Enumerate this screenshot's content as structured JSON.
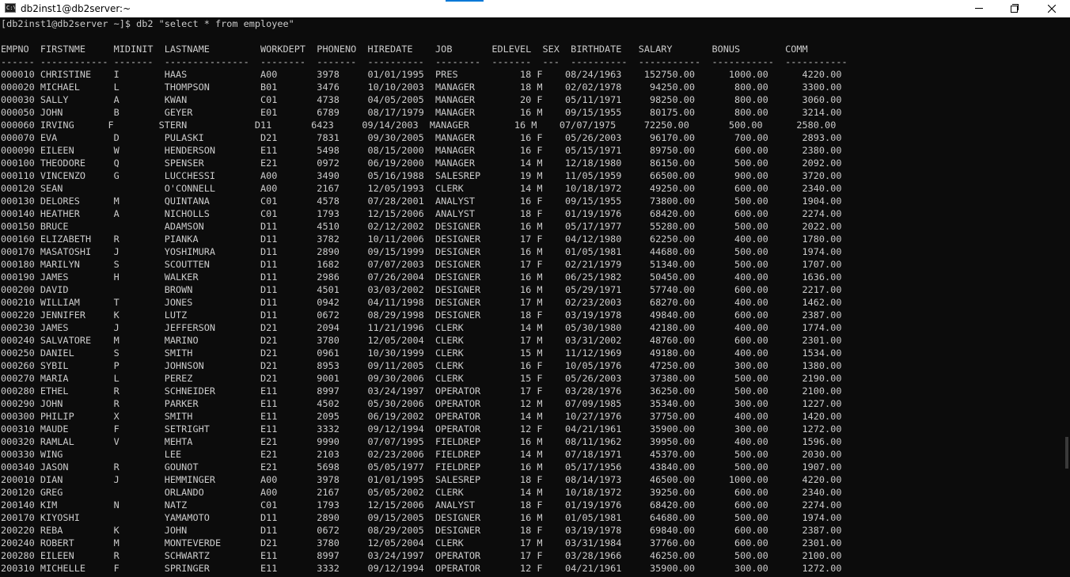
{
  "window": {
    "title": "db2inst1@db2server:~",
    "icon_text": "C:\\",
    "accent_color": "#0078d7"
  },
  "console": {
    "prompt_line": "[db2inst1@db2server ~]$ db2 \"select * from employee\"",
    "header_line": "EMPNO  FIRSTNME     MIDINIT  LASTNAME         WORKDEPT  PHONENO  HIREDATE    JOB       EDLEVEL  SEX  BIRTHDATE   SALARY       BONUS        COMM",
    "separator_line": "------ ------------ -------  ---------------  --------  -------  ----------  --------  -------  ---  ----------  -----------  -----------  -----------",
    "rows": [
      "000010 CHRISTINE    I        HAAS             A00       3978     01/01/1995  PRES           18 F    08/24/1963    152750.00      1000.00      4220.00",
      "000020 MICHAEL      L        THOMPSON         B01       3476     10/10/2003  MANAGER        18 M    02/02/1978     94250.00       800.00      3300.00",
      "000030 SALLY        A        KWAN             C01       4738     04/05/2005  MANAGER        20 F    05/11/1971     98250.00       800.00      3060.00",
      "000050 JOHN         B        GEYER            E01       6789     08/17/1979  MANAGER        16 M    09/15/1955     80175.00       800.00      3214.00",
      "000060 IRVING      F        STERN            D11       6423     09/14/2003  MANAGER        16 M    07/07/1975     72250.00       500.00      2580.00",
      "000070 EVA          D        PULASKI          D21       7831     09/30/2005  MANAGER        16 F    05/26/2003     96170.00       700.00      2893.00",
      "000090 EILEEN       W        HENDERSON        E11       5498     08/15/2000  MANAGER        16 F    05/15/1971     89750.00       600.00      2380.00",
      "000100 THEODORE     Q        SPENSER          E21       0972     06/19/2000  MANAGER        14 M    12/18/1980     86150.00       500.00      2092.00",
      "000110 VINCENZO     G        LUCCHESSI        A00       3490     05/16/1988  SALESREP       19 M    11/05/1959     66500.00       900.00      3720.00",
      "000120 SEAN                  O'CONNELL        A00       2167     12/05/1993  CLERK          14 M    10/18/1972     49250.00       600.00      2340.00",
      "000130 DELORES      M        QUINTANA         C01       4578     07/28/2001  ANALYST        16 F    09/15/1955     73800.00       500.00      1904.00",
      "000140 HEATHER      A        NICHOLLS         C01       1793     12/15/2006  ANALYST        18 F    01/19/1976     68420.00       600.00      2274.00",
      "000150 BRUCE                 ADAMSON          D11       4510     02/12/2002  DESIGNER       16 M    05/17/1977     55280.00       500.00      2022.00",
      "000160 ELIZABETH    R        PIANKA           D11       3782     10/11/2006  DESIGNER       17 F    04/12/1980     62250.00       400.00      1780.00",
      "000170 MASATOSHI    J        YOSHIMURA        D11       2890     09/15/1999  DESIGNER       16 M    01/05/1981     44680.00       500.00      1974.00",
      "000180 MARILYN      S        SCOUTTEN         D11       1682     07/07/2003  DESIGNER       17 F    02/21/1979     51340.00       500.00      1707.00",
      "000190 JAMES        H        WALKER           D11       2986     07/26/2004  DESIGNER       16 M    06/25/1982     50450.00       400.00      1636.00",
      "000200 DAVID                 BROWN            D11       4501     03/03/2002  DESIGNER       16 M    05/29/1971     57740.00       600.00      2217.00",
      "000210 WILLIAM      T        JONES            D11       0942     04/11/1998  DESIGNER       17 M    02/23/2003     68270.00       400.00      1462.00",
      "000220 JENNIFER     K        LUTZ             D11       0672     08/29/1998  DESIGNER       18 F    03/19/1978     49840.00       600.00      2387.00",
      "000230 JAMES        J        JEFFERSON        D21       2094     11/21/1996  CLERK          14 M    05/30/1980     42180.00       400.00      1774.00",
      "000240 SALVATORE    M        MARINO           D21       3780     12/05/2004  CLERK          17 M    03/31/2002     48760.00       600.00      2301.00",
      "000250 DANIEL       S        SMITH            D21       0961     10/30/1999  CLERK          15 M    11/12/1969     49180.00       400.00      1534.00",
      "000260 SYBIL        P        JOHNSON          D21       8953     09/11/2005  CLERK          16 F    10/05/1976     47250.00       300.00      1380.00",
      "000270 MARIA        L        PEREZ            D21       9001     09/30/2006  CLERK          15 F    05/26/2003     37380.00       500.00      2190.00",
      "000280 ETHEL        R        SCHNEIDER        E11       8997     03/24/1997  OPERATOR       17 F    03/28/1976     36250.00       500.00      2100.00",
      "000290 JOHN         R        PARKER           E11       4502     05/30/2006  OPERATOR       12 M    07/09/1985     35340.00       300.00      1227.00",
      "000300 PHILIP       X        SMITH            E11       2095     06/19/2002  OPERATOR       14 M    10/27/1976     37750.00       400.00      1420.00",
      "000310 MAUDE        F        SETRIGHT         E11       3332     09/12/1994  OPERATOR       12 F    04/21/1961     35900.00       300.00      1272.00",
      "000320 RAMLAL       V        MEHTA            E21       9990     07/07/1995  FIELDREP       16 M    08/11/1962     39950.00       400.00      1596.00",
      "000330 WING                  LEE              E21       2103     02/23/2006  FIELDREP       14 M    07/18/1971     45370.00       500.00      2030.00",
      "000340 JASON        R        GOUNOT           E21       5698     05/05/1977  FIELDREP       16 M    05/17/1956     43840.00       500.00      1907.00",
      "200010 DIAN         J        HEMMINGER        A00       3978     01/01/1995  SALESREP       18 F    08/14/1973     46500.00      1000.00      4220.00",
      "200120 GREG                  ORLANDO          A00       2167     05/05/2002  CLERK          14 M    10/18/1972     39250.00       600.00      2340.00",
      "200140 KIM          N        NATZ             C01       1793     12/15/2006  ANALYST        18 F    01/19/1976     68420.00       600.00      2274.00",
      "200170 KIYOSHI               YAMAMOTO         D11       2890     09/15/2005  DESIGNER       16 M    01/05/1981     64680.00       500.00      1974.00",
      "200220 REBA         K        JOHN             D11       0672     08/29/2005  DESIGNER       18 F    03/19/1978     69840.00       600.00      2387.00",
      "200240 ROBERT       M        MONTEVERDE       D21       3780     12/05/2004  CLERK          17 M    03/31/1984     37760.00       600.00      2301.00",
      "200280 EILEEN       R        SCHWARTZ         E11       8997     03/24/1997  OPERATOR       17 F    03/28/1966     46250.00       500.00      2100.00",
      "200310 MICHELLE     F        SPRINGER         E11       3332     09/12/1994  OPERATOR       12 F    04/21/1961     35900.00       300.00      1272.00"
    ]
  }
}
